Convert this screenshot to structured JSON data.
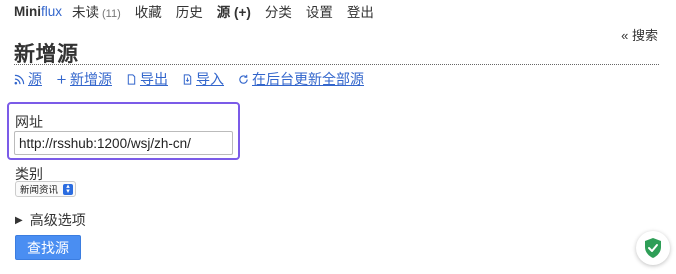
{
  "nav": {
    "logo_mini": "Mini",
    "logo_flux": "flux",
    "items": [
      {
        "label": "未读",
        "badge": "(11)"
      },
      {
        "label": "收藏"
      },
      {
        "label": "历史"
      },
      {
        "label": "源 (+)"
      },
      {
        "label": "分类"
      },
      {
        "label": "设置"
      },
      {
        "label": "登出"
      }
    ],
    "search_toggle": "« 搜索"
  },
  "page": {
    "title": "新增源",
    "sub_menu": [
      {
        "label": "源",
        "icon": "rss-icon"
      },
      {
        "label": "新增源",
        "icon": "plus-icon"
      },
      {
        "label": "导出",
        "icon": "export-icon"
      },
      {
        "label": "导入",
        "icon": "import-icon"
      },
      {
        "label": "在后台更新全部源",
        "icon": "refresh-icon"
      }
    ]
  },
  "form": {
    "url_label": "网址",
    "url_value": "http://rsshub:1200/wsj/zh-cn/",
    "category_label": "类别",
    "category_value": "新闻资讯",
    "advanced_label": "高级选项",
    "submit_label": "查找源"
  },
  "colors": {
    "link": "#3366cc",
    "focus_border": "#7b5be8",
    "button": "#4a8ef2",
    "shield": "#2e9e57"
  }
}
